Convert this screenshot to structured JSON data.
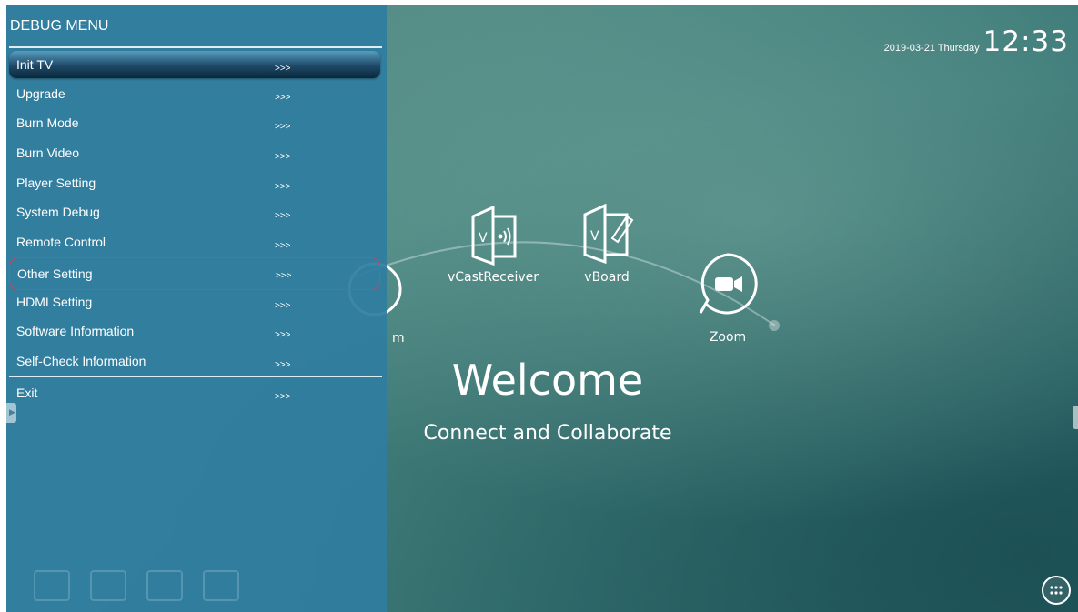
{
  "clock": {
    "date": "2019-03-21 Thursday",
    "time": "12:33"
  },
  "menu": {
    "title": "DEBUG MENU",
    "arrow": ">>>",
    "items": [
      {
        "label": "Init TV"
      },
      {
        "label": "Upgrade"
      },
      {
        "label": "Burn Mode"
      },
      {
        "label": "Burn Video"
      },
      {
        "label": "Player Setting"
      },
      {
        "label": "System Debug"
      },
      {
        "label": "Remote Control"
      },
      {
        "label": "Other Setting"
      },
      {
        "label": "HDMI Setting"
      },
      {
        "label": "Software Information"
      },
      {
        "label": "Self-Check Information"
      }
    ],
    "exit": {
      "label": "Exit"
    }
  },
  "launcher": {
    "apps": [
      {
        "label": "m",
        "icon": "partially-hidden-app-icon"
      },
      {
        "label": "vCastReceiver",
        "icon": "vcast-receiver-icon"
      },
      {
        "label": "vBoard",
        "icon": "vboard-icon"
      },
      {
        "label": "Zoom",
        "icon": "zoom-video-icon"
      }
    ],
    "welcome": "Welcome",
    "tagline": "Connect and Collaborate"
  },
  "colors": {
    "menu_bg": "#2f7da0",
    "focus_outline": "#c24a59",
    "wallpaper": "#4f8a84"
  }
}
